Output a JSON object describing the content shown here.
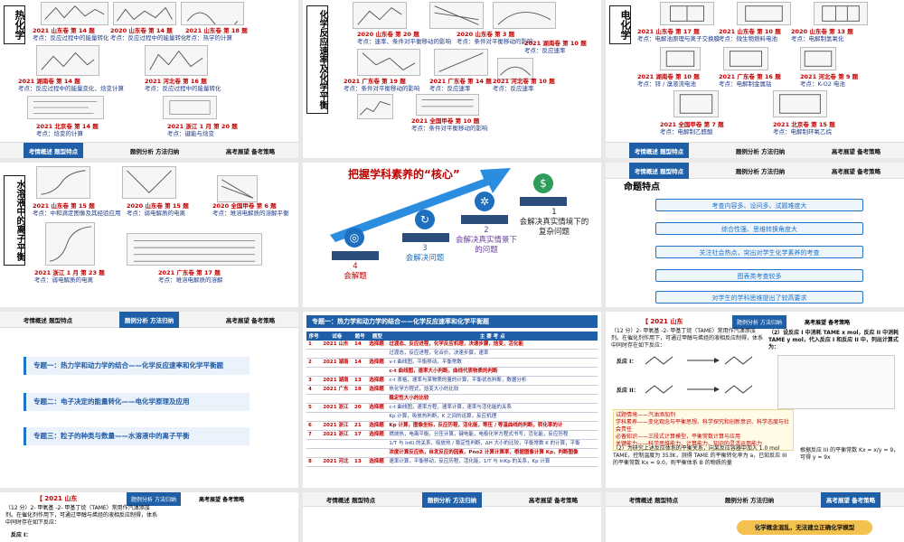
{
  "slides": {
    "s1": {
      "vertical_title": "热化学",
      "captions": [
        {
          "year": "2021 山东卷 第 14 题",
          "point": "考点：反应过程中的能量转化"
        },
        {
          "year": "2020 山东卷 第 14 题",
          "point": "考点：反应过程中的能量转化"
        },
        {
          "year": "2021 山东卷 第 18 题",
          "point": "考点：热学的计算"
        },
        {
          "year": "2021 湖南卷 第 14 题",
          "point": "考点：反应过程中的能量变化、焓变计算"
        },
        {
          "year": "2021 河北卷 第 16 题",
          "point": "考点：反应过程中的能量转化"
        },
        {
          "year": "2021 北京卷 第 14 题",
          "point": "考点：焓变的计算"
        },
        {
          "year": "2021 浙江 1 月 第 20 题",
          "point": "考点：键能与焓变"
        }
      ]
    },
    "s2": {
      "vertical_title": "化学反应速率及化学平衡",
      "captions": [
        {
          "year": "2020 山东卷 第 20 题",
          "point": "考点：速率、条件对平衡移动的影响"
        },
        {
          "year": "2020 山东卷 第 3 题",
          "point": "考点：条件对平衡移动的影响"
        },
        {
          "year": "2021 湖南卷 第 10 题",
          "point": "考点：反应速率"
        },
        {
          "year": "2021 广东卷 第 19 题",
          "point": "考点：条件对平衡移动的影响"
        },
        {
          "year": "2021 广东卷 第 14 题",
          "point": "考点：反应速率"
        },
        {
          "year": "2021 河北卷 第 10 题",
          "point": "考点：反应速率"
        },
        {
          "year": "2021 全国甲卷 第 10 题",
          "point": "考点：条件对平衡移动的影响"
        }
      ]
    },
    "s3": {
      "vertical_title": "电化学",
      "captions": [
        {
          "year": "2021 山东卷 第 17 题",
          "point": "考点：电解池原理与离子交换膜"
        },
        {
          "year": "2021 山东卷 第 10 题",
          "point": "考点：微生物燃料电池"
        },
        {
          "year": "2020 山东卷 第 13 题",
          "point": "考点：电解制氢氧化"
        },
        {
          "year": "2021 湖南卷 第 10 题",
          "point": "考点：锌 / 溴液流电池"
        },
        {
          "year": "2021 广东卷 第 16 题",
          "point": "考点：电解制金属钴"
        },
        {
          "year": "2021 河北卷 第 9 题",
          "point": "考点：K-O2 电池"
        },
        {
          "year": "2021 全国甲卷 第 7 题",
          "point": "考点：电解制乙醛酸"
        },
        {
          "year": "2021 北京卷 第 15 题",
          "point": "考点：电解制环氧乙烷"
        }
      ]
    },
    "s4": {
      "vertical_title": "水溶液中的离子平衡",
      "captions": [
        {
          "year": "2021 山东卷 第 15 题",
          "point": "考点：中和滴定图像及其经验应用"
        },
        {
          "year": "2020 山东卷 第 15 题",
          "point": "考点：弱电解质的电离"
        },
        {
          "year": "2020 全国甲卷 第 6 题",
          "point": "考点：难溶电解质的溶解平衡"
        },
        {
          "year": "2021 浙江 1 月 第 23 题",
          "point": "考点：弱电解质的电离"
        },
        {
          "year": "2021 广东卷 第 17 题",
          "point": "考点：难溶电解质的溶解"
        }
      ]
    },
    "s5": {
      "headline": "把握学科素养的“核心”",
      "steps": [
        {
          "num": "1",
          "text": "会解决真实情境下的复杂问题",
          "icon": "dollar-icon"
        },
        {
          "num": "2",
          "text": "会解决真实情景下的问题",
          "icon": "gear-icon"
        },
        {
          "num": "3",
          "text": "会解决问题",
          "icon": "refresh-icon"
        },
        {
          "num": "4",
          "text": "会解题",
          "icon": "target-icon"
        }
      ]
    },
    "s6": {
      "title": "命题特点",
      "items": [
        "考查内容多、设问多、试题难度大",
        "综合性强、思维转换角度大",
        "关注社会热点，突出对学生化学素养的考查",
        "图表类考查较多",
        "对学生的学科思维提出了较高要求"
      ]
    },
    "s7": {
      "topics": [
        "专题一：热力学和动力学的结合——化学反应速率和化学平衡题",
        "专题二：电子决定的能量转化——电化学原理及应用",
        "专题三：粒子的种类与数量——水溶液中的离子平衡"
      ]
    },
    "s8": {
      "header": "专题一：热力学和动力学的结合——化学反应速率和化学平衡题",
      "columns": [
        "序号",
        "试卷",
        "题号",
        "题型",
        "主 要 考 点"
      ],
      "rows": [
        {
          "n": "1",
          "paper": "2021 山东",
          "q": "14",
          "type": "选择题",
          "point": "过渡态、反应进程，化学反应机理，决速步骤，焓变，活化能"
        },
        {
          "n": "",
          "paper": "",
          "q": "",
          "type": "",
          "point": "过渡态，反应进程，化合价，决速步骤，速率"
        },
        {
          "n": "2",
          "paper": "2021 湖南",
          "q": "14",
          "type": "选择题",
          "point": "v-t 曲线图，平衡移动，平衡常数"
        },
        {
          "n": "",
          "paper": "",
          "q": "",
          "type": "",
          "point": "c-t 曲线图，速率大小判断，曲线代表物质的判断"
        },
        {
          "n": "3",
          "paper": "2021 湖南",
          "q": "13",
          "type": "选择题",
          "point": "c-t 表格，速率与某物质的量的计算，平衡状态判断，数据分析"
        },
        {
          "n": "4",
          "paper": "2021 广东",
          "q": "19",
          "type": "选择题",
          "point": "热化学方程式，焓变大小的比较"
        },
        {
          "n": "",
          "paper": "",
          "q": "",
          "type": "",
          "point": "稳定性大小的比较"
        },
        {
          "n": "5",
          "paper": "2021 浙江",
          "q": "20",
          "type": "选择题",
          "point": "c-t 曲线图，速率方程，速率计算，速率与活化能的关系"
        },
        {
          "n": "",
          "paper": "",
          "q": "",
          "type": "",
          "point": "Kp 计算，吸放热判断，K 之间的运算，反应机理"
        },
        {
          "n": "6",
          "paper": "2021 浙江",
          "q": "21",
          "type": "选择题",
          "point": "Kp 计算，图像坐标，反应历程，活化能，等压 / 等温曲线的判断，转化率的计"
        },
        {
          "n": "7",
          "paper": "2021 浙江",
          "q": "17",
          "type": "选择题",
          "point": "燃烧热，电离平衡，分压计算，键电能，电极化学方程式书写，活化能，反应历程"
        },
        {
          "n": "",
          "paper": "",
          "q": "",
          "type": "",
          "point": "1/T 与 lnKi 的关系，吸放热 / 稳定性判断，ΔH 大小的比较，平衡常数 K 的计算，平衡"
        },
        {
          "n": "",
          "paper": "",
          "q": "",
          "type": "",
          "point": "浓度计算反应热，自发反应的因素，Pno2 计算计算率，根据图像计算 Kp，判断图像"
        },
        {
          "n": "8",
          "paper": "2021 河北",
          "q": "13",
          "type": "选择题",
          "point": "速率计算，平衡移动，反应历程，活化能，1/T 与 lnKp 的关系，Kp 计算"
        }
      ]
    },
    "s9": {
      "badge": "【 2021 山东",
      "intro": "（12 分）2- 甲氧基 -2- 甲基丁烷（TAME）常用作汽油添加剂。在催化剂作用下，可通过甲醇与烯烃的液相反应制得，体系中同时存在如下反应：",
      "reaction1": "反应 I：",
      "reaction2": "反应 II：",
      "condition": "（2）设反应 I 中消耗 TAME x mol，反应 II 中消耗 TAME y mol，代入反应 I 和反应 II 中，列出计算式为：",
      "note1": "试题情境——汽油添加剂",
      "note2": "学科素养——变化观念与平衡思想、科学探究和创新意识、科学态度与社会责任",
      "note3": "必备知识——三段式计算模型，平衡常数计算与应用",
      "note4": "关键能力——科学思维能力、计算能力、知识的灵活运用能力",
      "q2": "（2）为研究上述反应体系的平衡关系，向某反应容器中加入 1.0 mol TAME，控制温度为 353K，测得 TAME 的平衡转化率为 a，已知反应 III 的平衡常数 Kx = 9.0，则平衡体系 B 的物质的量",
      "formula": "根据反应 III 的平衡常数 Kx = x/y = 9，可得 y = 9x"
    },
    "s10": {
      "badge": "【 2021 山东",
      "intro": "（12 分）2- 甲氧基 -2- 甲基丁烷（TAME）常用作汽油添加剂。在催化剂作用下，可通过甲醇与烯烃的液相反应制得，体系中同时存在如下反应：",
      "reaction1": "反应 I："
    },
    "s12": {
      "notice": "化学概念混乱，无法建立正确化学模型"
    }
  },
  "nav": {
    "overview": "考情概述",
    "features": "题型特点",
    "analysis": "题例分析",
    "method": "方法归纳",
    "outlook": "高考展望",
    "strategy": "备考策略"
  },
  "colors": {
    "accent": "#1e5fa8",
    "caption_red": "#c00000",
    "caption_blue": "#1f3a8a",
    "arrow": "#2a8de0"
  }
}
